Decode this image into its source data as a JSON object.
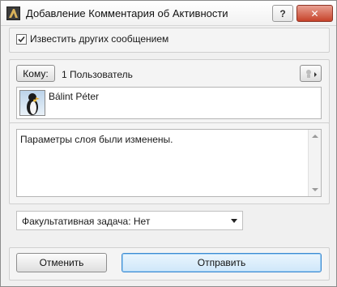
{
  "window": {
    "title": "Добавление Комментария об Активности",
    "help_label": "?",
    "close_label": "✕"
  },
  "notify": {
    "label": "Известить других сообщением",
    "checked": true
  },
  "recipients": {
    "to_button_label": "Кому:",
    "count_text": "1 Пользователь",
    "users": [
      {
        "name": "Bálint Péter",
        "avatar_icon": "penguin-avatar"
      }
    ]
  },
  "comment": {
    "text": "Параметры слоя были изменены."
  },
  "task": {
    "selected": "Факультативная задача: Нет"
  },
  "actions": {
    "cancel_label": "Отменить",
    "send_label": "Отправить"
  }
}
